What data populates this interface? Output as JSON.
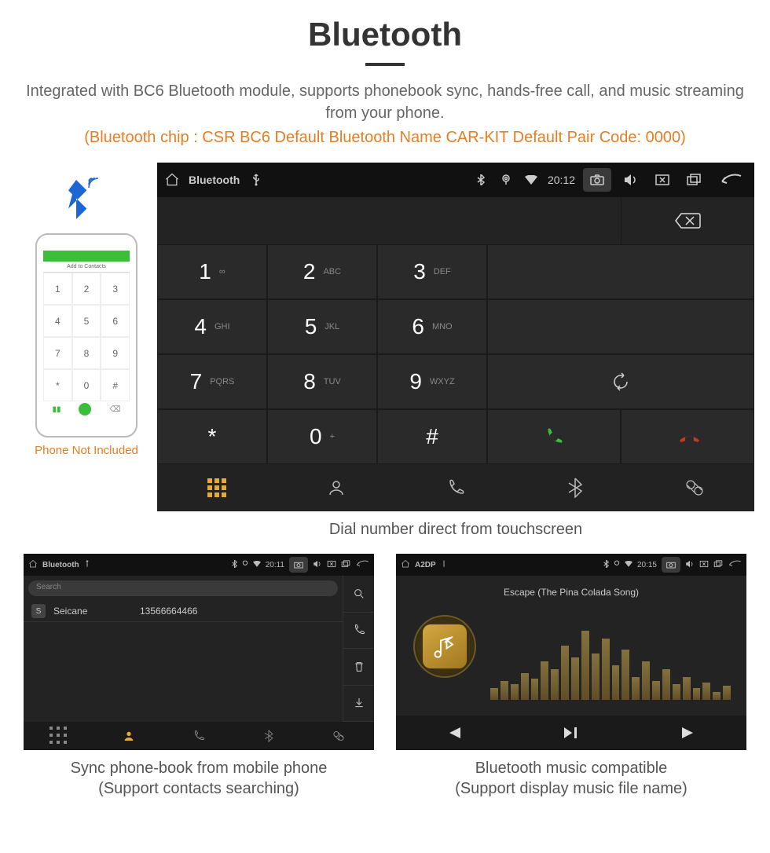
{
  "title": "Bluetooth",
  "description": "Integrated with BC6 Bluetooth module, supports phonebook sync, hands-free call, and music streaming from your phone.",
  "spec_line": "(Bluetooth chip : CSR BC6     Default Bluetooth Name CAR-KIT     Default Pair Code: 0000)",
  "phone_not_included": "Phone Not Included",
  "phone_add_contact": "Add to Contacts",
  "topbar": {
    "app": "Bluetooth",
    "time": "20:12"
  },
  "keys": [
    {
      "num": "1",
      "sub": "∞"
    },
    {
      "num": "2",
      "sub": "ABC"
    },
    {
      "num": "3",
      "sub": "DEF"
    },
    {
      "num": "4",
      "sub": "GHI"
    },
    {
      "num": "5",
      "sub": "JKL"
    },
    {
      "num": "6",
      "sub": "MNO"
    },
    {
      "num": "7",
      "sub": "PQRS"
    },
    {
      "num": "8",
      "sub": "TUV"
    },
    {
      "num": "9",
      "sub": "WXYZ"
    },
    {
      "num": "*",
      "sub": ""
    },
    {
      "num": "0",
      "sub": "+"
    },
    {
      "num": "#",
      "sub": ""
    }
  ],
  "caption_dialer": "Dial number direct from touchscreen",
  "contacts": {
    "topbar_app": "Bluetooth",
    "topbar_time": "20:11",
    "search_placeholder": "Search",
    "list": [
      {
        "initial": "S",
        "name": "Seicane",
        "number": "13566664466"
      }
    ]
  },
  "caption_contacts_l1": "Sync phone-book from mobile phone",
  "caption_contacts_l2": "(Support contacts searching)",
  "music": {
    "topbar_app": "A2DP",
    "topbar_time": "20:15",
    "track": "Escape (The Pina Colada Song)"
  },
  "caption_music_l1": "Bluetooth music compatible",
  "caption_music_l2": "(Support display music file name)"
}
